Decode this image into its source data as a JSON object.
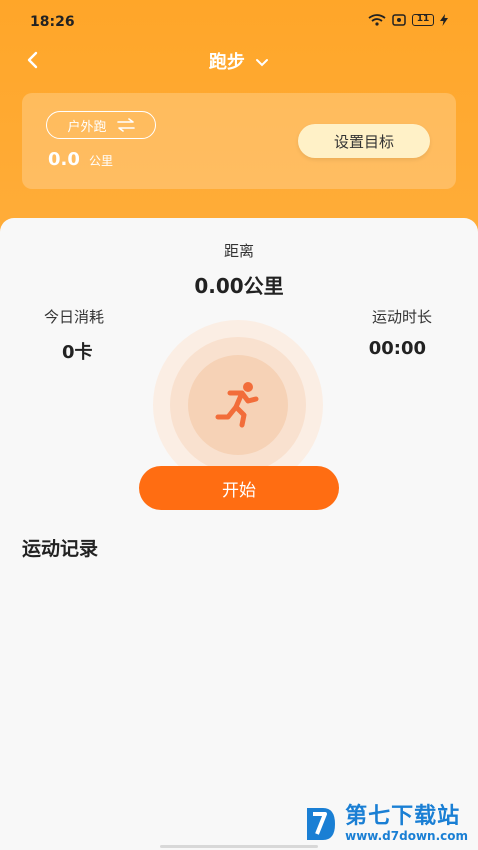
{
  "status_bar": {
    "time": "18:26",
    "battery": "11"
  },
  "nav": {
    "title": "跑步"
  },
  "run_card": {
    "mode_label": "户外跑",
    "goal_value": "0.0",
    "goal_unit": "公里",
    "goal_button": "设置目标"
  },
  "stats": {
    "distance_label": "距离",
    "distance_value": "0.00公里",
    "calories_label": "今日消耗",
    "calories_value": "0卡",
    "duration_label": "运动时长",
    "duration_value": "00:00"
  },
  "actions": {
    "start_button": "开始"
  },
  "records": {
    "title": "运动记录"
  },
  "watermark": {
    "title": "第七下载站",
    "url": "www.d7down.com"
  },
  "colors": {
    "header": "#ffa629",
    "accent": "#ff6d12",
    "goal_button_bg": "#fff1c7"
  }
}
